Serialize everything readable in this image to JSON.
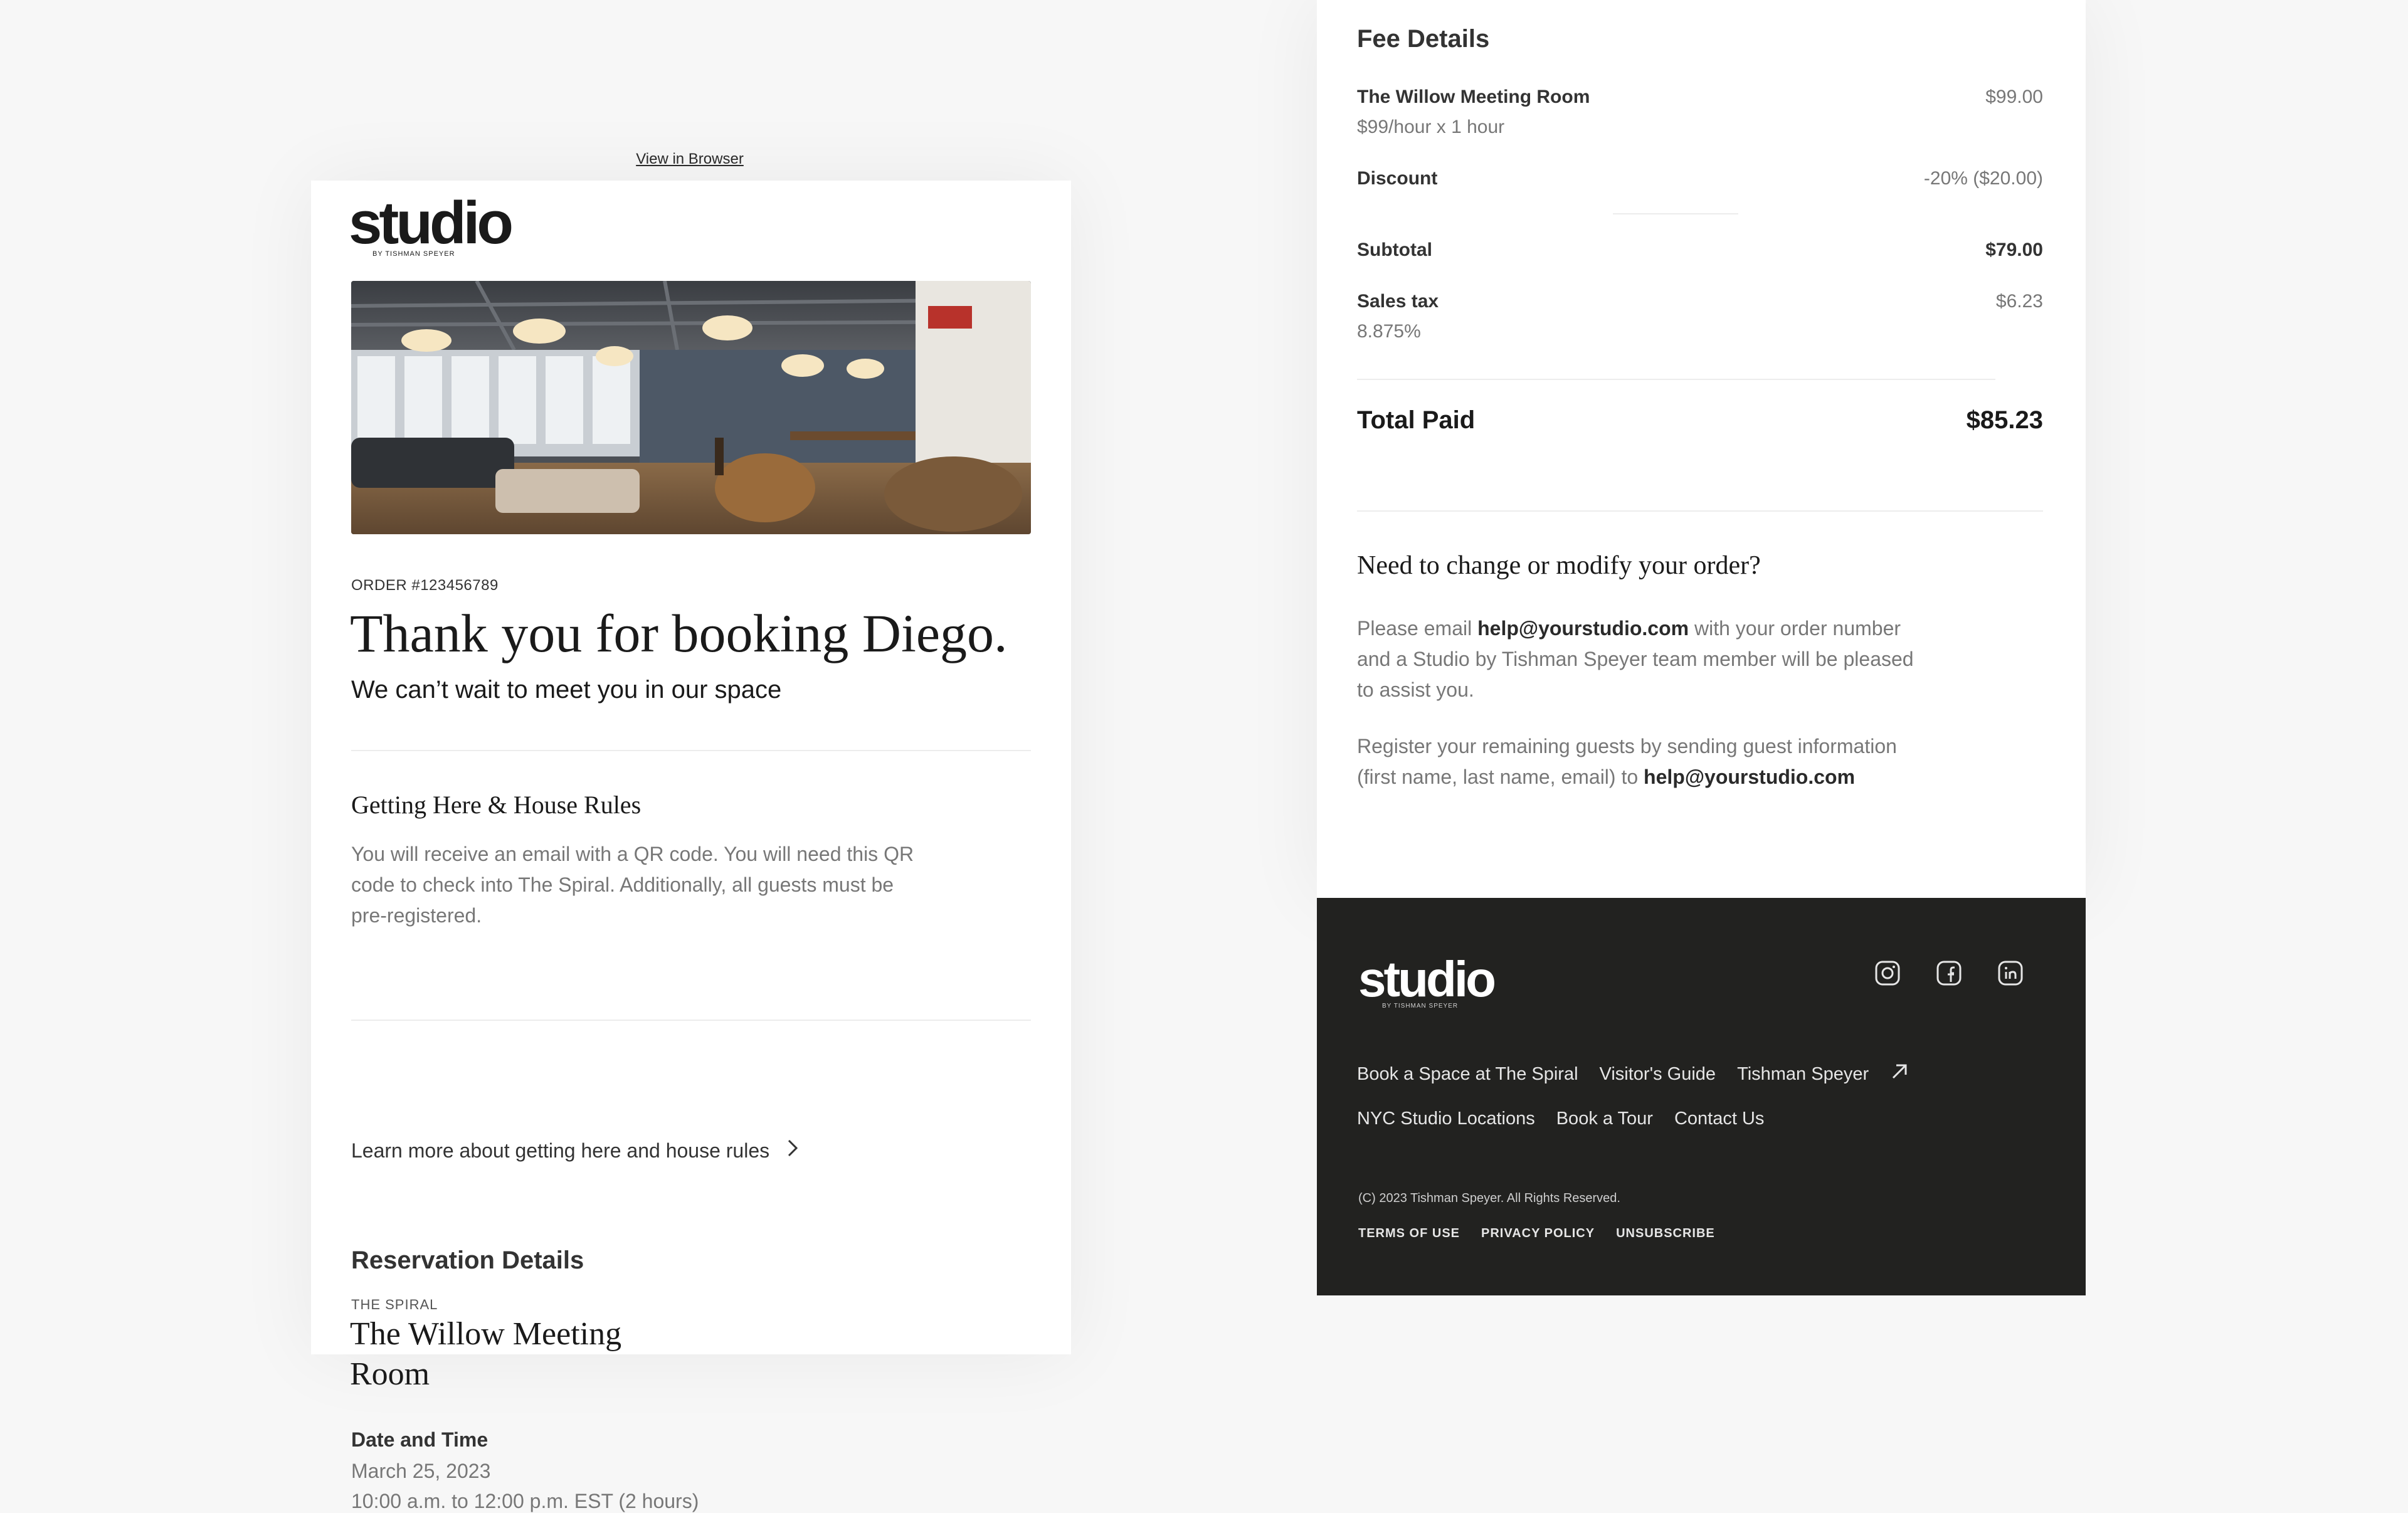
{
  "header": {
    "view_in_browser": "View in Browser"
  },
  "brand": {
    "name": "studio",
    "byline": "BY TISHMAN SPEYER"
  },
  "confirmation": {
    "order_number": "ORDER #123456789",
    "headline": "Thank you for booking Diego.",
    "subheadline": "We can’t wait to meet you in our space"
  },
  "getting_here": {
    "title": "Getting Here & House Rules",
    "lines": [
      "You will receive an email with a QR code. You will need this QR",
      "code to check into The Spiral. Additionally, all guests must be",
      "pre-registered."
    ],
    "link_label": "Learn more about getting here and house rules"
  },
  "reservation": {
    "title": "Reservation Details",
    "location": "THE SPIRAL",
    "room_line1": "The Willow Meeting",
    "room_line2": "Room",
    "date_title": "Date and Time",
    "date": "March 25, 2023",
    "time": "10:00 a.m. to 12:00 p.m. EST (2 hours)"
  },
  "fees": {
    "title": "Fee Details",
    "room_label": "The Willow Meeting Room",
    "room_rate": "$99/hour x 1 hour",
    "room_amount": "$99.00",
    "discount_label": "Discount",
    "discount_amount": "-20% ($20.00)",
    "subtotal_label": "Subtotal",
    "subtotal_amount": "$79.00",
    "tax_label": "Sales tax",
    "tax_rate": "8.875%",
    "tax_amount": "$6.23",
    "total_label": "Total Paid",
    "total_amount": "$85.23"
  },
  "help": {
    "title": "Need to change or modify your order?",
    "p1_a": "Please email ",
    "email": "help@yourstudio.com",
    "p1_b": " with your order number",
    "p1_c": "and a Studio by Tishman Speyer team member will be pleased",
    "p1_d": "to assist you.",
    "p2_a": "Register your remaining guests by sending guest information",
    "p2_b": "(first name, last name, email) to "
  },
  "footer": {
    "links_row1": [
      "Book a Space at The Spiral",
      "Visitor's Guide",
      "Tishman Speyer"
    ],
    "links_row2": [
      "NYC Studio Locations",
      "Book a Tour",
      "Contact Us"
    ],
    "copyright": "(C) 2023 Tishman Speyer. All Rights Reserved.",
    "legal": [
      "TERMS OF USE",
      "PRIVACY POLICY",
      "UNSUBSCRIBE"
    ],
    "social_icons": [
      "instagram-icon",
      "facebook-icon",
      "linkedin-icon"
    ]
  },
  "colors": {
    "footer_bg": "#222220",
    "muted_text": "#777777",
    "primary_text": "#1a1a1a"
  }
}
